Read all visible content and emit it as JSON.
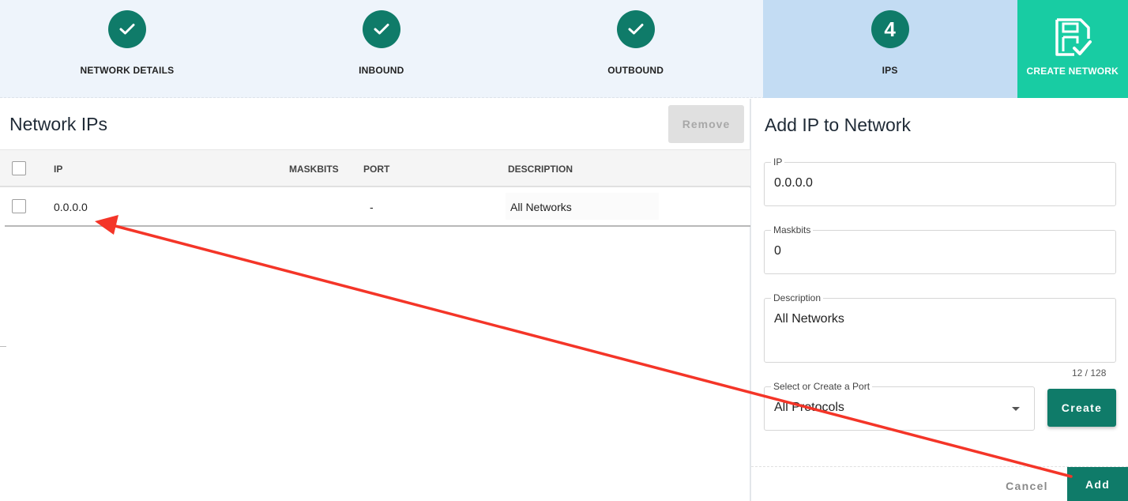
{
  "stepper": {
    "steps": [
      {
        "label": "NETWORK DETAILS",
        "state": "complete"
      },
      {
        "label": "INBOUND",
        "state": "complete"
      },
      {
        "label": "OUTBOUND",
        "state": "complete"
      },
      {
        "label": "IPS",
        "state": "active",
        "number": "4"
      }
    ],
    "create_label": "CREATE NETWORK"
  },
  "left": {
    "title": "Network IPs",
    "remove_label": "Remove",
    "columns": [
      "IP",
      "MASKBITS",
      "PORT",
      "DESCRIPTION"
    ],
    "rows": [
      {
        "ip": "0.0.0.0",
        "maskbits": "",
        "port": "-",
        "description": "All Networks"
      }
    ]
  },
  "right": {
    "title": "Add IP to Network",
    "ip": {
      "label": "IP",
      "value": "0.0.0.0"
    },
    "maskbits": {
      "label": "Maskbits",
      "value": "0"
    },
    "description": {
      "label": "Description",
      "value": "All Networks"
    },
    "counter": "12 / 128",
    "port": {
      "label": "Select or Create a Port",
      "value": "All Protocols"
    },
    "create_label": "Create",
    "cancel_label": "Cancel",
    "add_label": "Add"
  },
  "colors": {
    "primary": "#0f7b69",
    "accent": "#18cca3",
    "stepper_bg": "#eef4fb",
    "stepper_active": "#c3dcf3",
    "annotation_arrow": "#f43528"
  },
  "icons": [
    "check-icon",
    "save-network-icon",
    "chevron-down-icon"
  ]
}
